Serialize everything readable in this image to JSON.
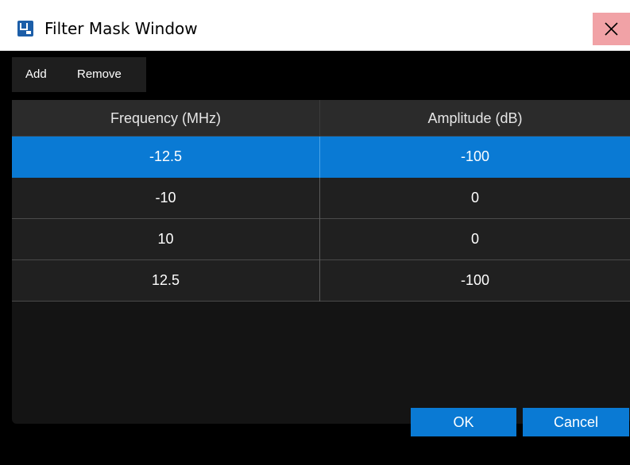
{
  "window": {
    "title": "Filter Mask Window"
  },
  "toolbar": {
    "add_label": "Add",
    "remove_label": "Remove"
  },
  "table": {
    "columns": [
      "Frequency (MHz)",
      "Amplitude (dB)"
    ],
    "rows": [
      {
        "frequency": "-12.5",
        "amplitude": "-100",
        "selected": true
      },
      {
        "frequency": "-10",
        "amplitude": "0",
        "selected": false
      },
      {
        "frequency": "10",
        "amplitude": "0",
        "selected": false
      },
      {
        "frequency": "12.5",
        "amplitude": "-100",
        "selected": false
      }
    ]
  },
  "footer": {
    "ok_label": "OK",
    "cancel_label": "Cancel"
  },
  "colors": {
    "accent": "#0a7ad4",
    "close_hover": "#f1a2a6",
    "background": "#000000",
    "grid_background": "#141414"
  },
  "icons": {
    "app": "app-window-icon",
    "close": "close-icon"
  }
}
